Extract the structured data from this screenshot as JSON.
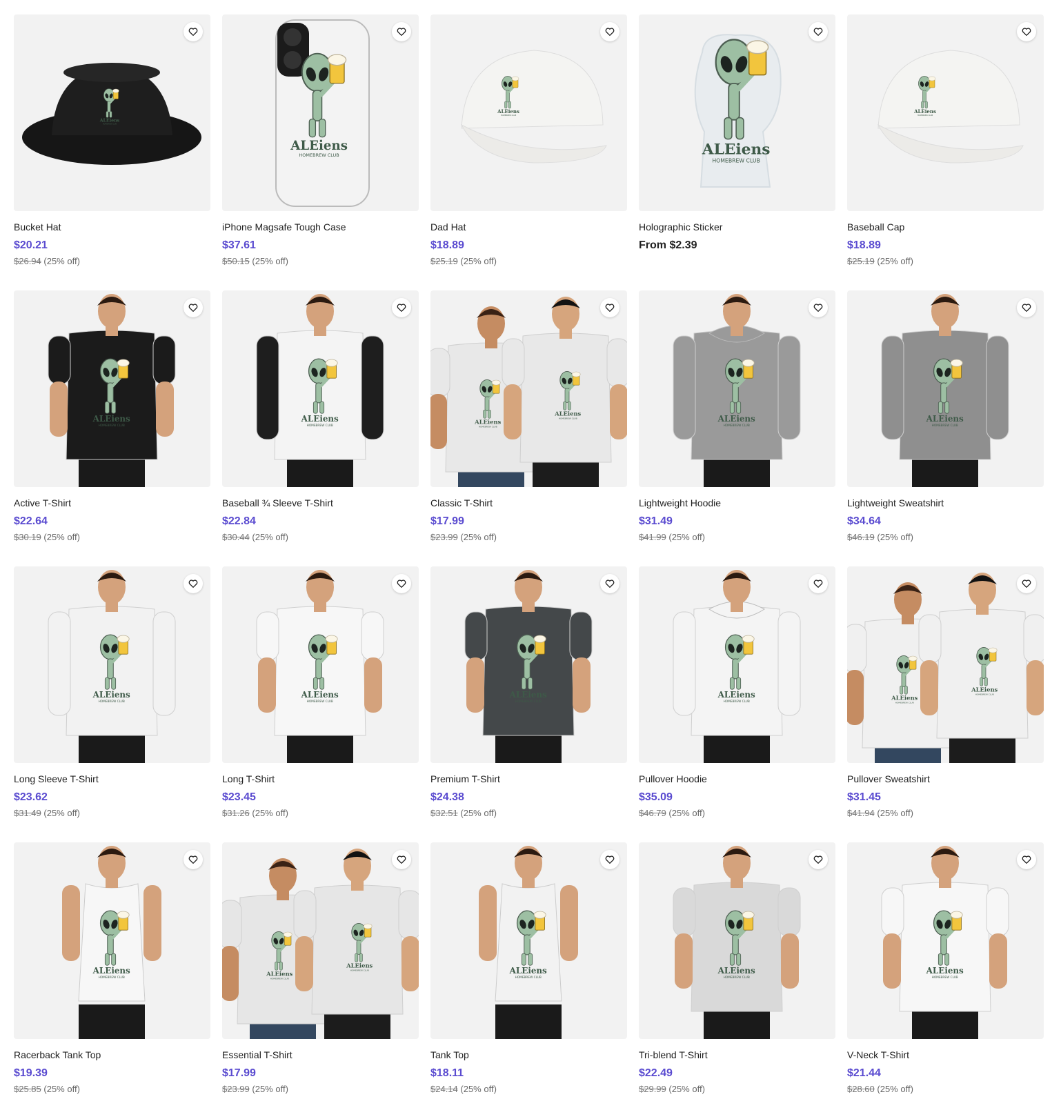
{
  "colors": {
    "accent": "#5a4bd0",
    "tile_bg": "#f2f2f2",
    "alien": "#9dbfa3",
    "beer": "#f2c53d"
  },
  "products": [
    {
      "title": "Bucket Hat",
      "price": "$20.21",
      "original": "$26.94",
      "discount": "(25% off)",
      "kind": "bucket"
    },
    {
      "title": "iPhone Magsafe Tough Case",
      "price": "$37.61",
      "original": "$50.15",
      "discount": "(25% off)",
      "kind": "phone"
    },
    {
      "title": "Dad Hat",
      "price": "$18.89",
      "original": "$25.19",
      "discount": "(25% off)",
      "kind": "cap"
    },
    {
      "title": "Holographic Sticker",
      "price": "From $2.39",
      "original": "",
      "discount": "",
      "kind": "sticker"
    },
    {
      "title": "Baseball Cap",
      "price": "$18.89",
      "original": "$25.19",
      "discount": "(25% off)",
      "kind": "cap"
    },
    {
      "title": "Active T-Shirt",
      "price": "$22.64",
      "original": "$30.19",
      "discount": "(25% off)",
      "kind": "shirt",
      "garment": "#1b1b1b"
    },
    {
      "title": "Baseball ¾ Sleeve T-Shirt",
      "price": "$22.84",
      "original": "$30.44",
      "discount": "(25% off)",
      "kind": "raglan",
      "garment": "#f4f4f4"
    },
    {
      "title": "Classic T-Shirt",
      "price": "$17.99",
      "original": "$23.99",
      "discount": "(25% off)",
      "kind": "couple",
      "garment": "#e8e8e8"
    },
    {
      "title": "Lightweight Hoodie",
      "price": "$31.49",
      "original": "$41.99",
      "discount": "(25% off)",
      "kind": "hoodie",
      "garment": "#9a9a9a"
    },
    {
      "title": "Lightweight Sweatshirt",
      "price": "$34.64",
      "original": "$46.19",
      "discount": "(25% off)",
      "kind": "longsleeve",
      "garment": "#8f8f8f"
    },
    {
      "title": "Long Sleeve T-Shirt",
      "price": "$23.62",
      "original": "$31.49",
      "discount": "(25% off)",
      "kind": "longsleeve",
      "garment": "#f2f2f2"
    },
    {
      "title": "Long T-Shirt",
      "price": "$23.45",
      "original": "$31.26",
      "discount": "(25% off)",
      "kind": "shirt",
      "garment": "#f7f7f7"
    },
    {
      "title": "Premium T-Shirt",
      "price": "$24.38",
      "original": "$32.51",
      "discount": "(25% off)",
      "kind": "shirt",
      "garment": "#44484a"
    },
    {
      "title": "Pullover Hoodie",
      "price": "$35.09",
      "original": "$46.79",
      "discount": "(25% off)",
      "kind": "hoodie",
      "garment": "#f4f4f4"
    },
    {
      "title": "Pullover Sweatshirt",
      "price": "$31.45",
      "original": "$41.94",
      "discount": "(25% off)",
      "kind": "couple",
      "garment": "#f0f0f0"
    },
    {
      "title": "Racerback Tank Top",
      "price": "$19.39",
      "original": "$25.85",
      "discount": "(25% off)",
      "kind": "tank",
      "garment": "#f7f7f7"
    },
    {
      "title": "Essential T-Shirt",
      "price": "$17.99",
      "original": "$23.99",
      "discount": "(25% off)",
      "kind": "couple",
      "garment": "#e6e6e6"
    },
    {
      "title": "Tank Top",
      "price": "$18.11",
      "original": "$24.14",
      "discount": "(25% off)",
      "kind": "tank",
      "garment": "#f2f2f2"
    },
    {
      "title": "Tri-blend T-Shirt",
      "price": "$22.49",
      "original": "$29.99",
      "discount": "(25% off)",
      "kind": "shirt",
      "garment": "#d9d9d9"
    },
    {
      "title": "V-Neck T-Shirt",
      "price": "$21.44",
      "original": "$28.60",
      "discount": "(25% off)",
      "kind": "shirt",
      "garment": "#f7f7f7"
    }
  ]
}
